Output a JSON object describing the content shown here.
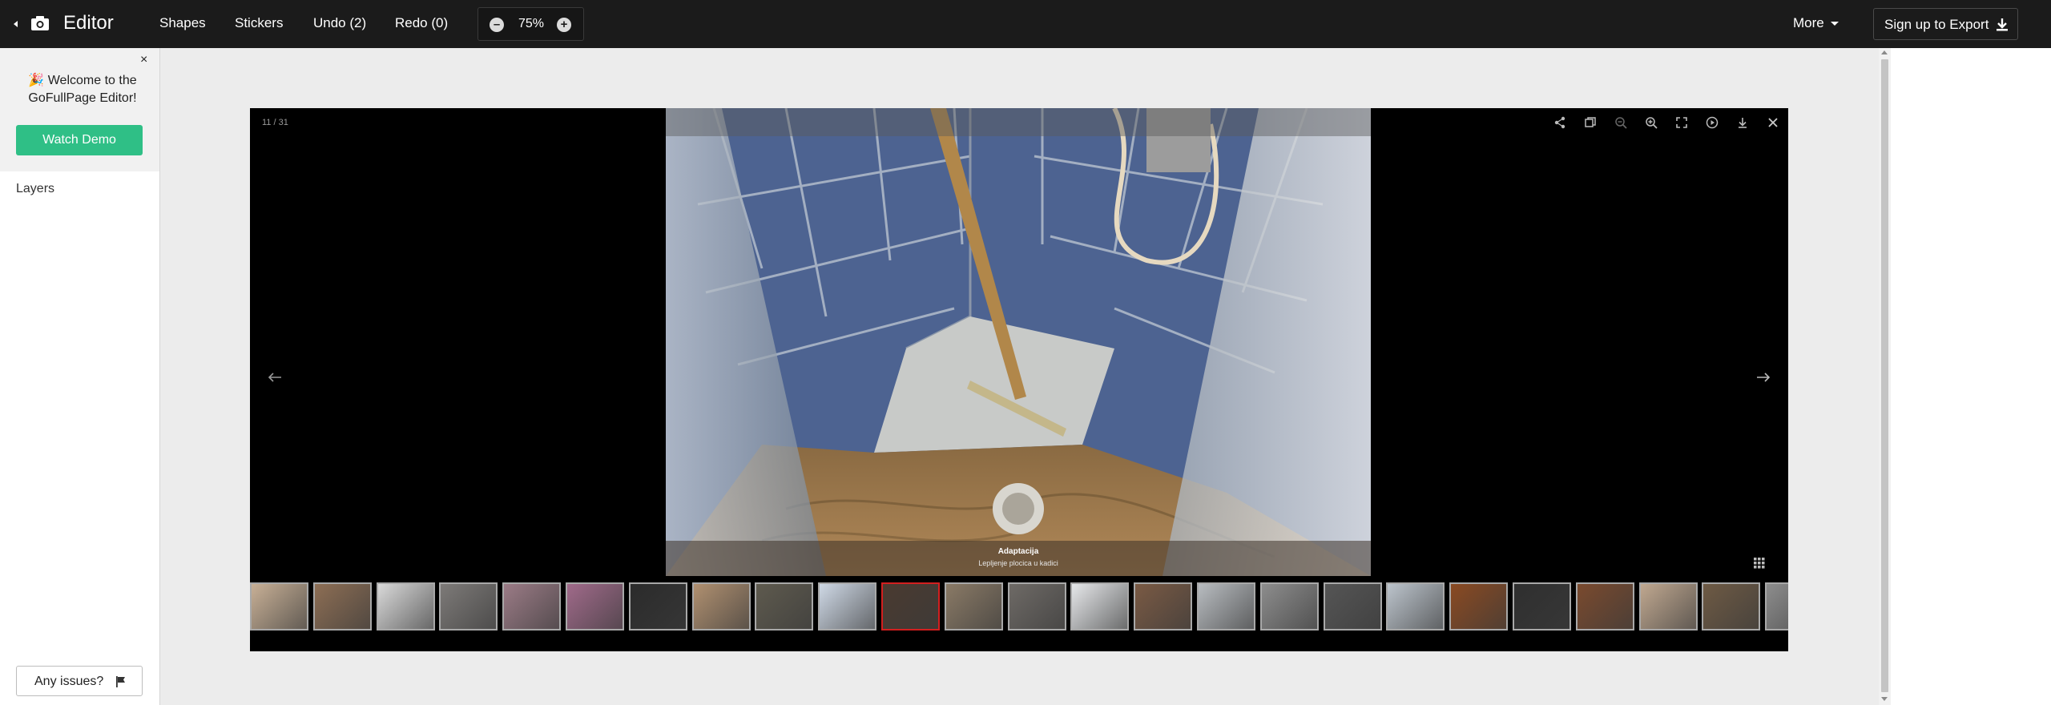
{
  "topbar": {
    "title": "Editor",
    "shapes": "Shapes",
    "stickers": "Stickers",
    "undo": "Undo (2)",
    "redo": "Redo (0)",
    "zoom_minus": "–",
    "zoom_value": "75%",
    "zoom_plus": "+",
    "more": "More",
    "signup": "Sign up to Export"
  },
  "sidebar": {
    "welcome_close": "×",
    "welcome_text": "🎉 Welcome to the GoFullPage Editor!",
    "watch_demo": "Watch Demo",
    "layers": "Layers",
    "issues": "Any issues?"
  },
  "lightbox": {
    "counter": "11 / 31",
    "caption_title": "Adaptacija",
    "caption_subtitle": "Lepljenje plocica u kadici",
    "active_thumb_index": 10,
    "thumb_colors": [
      "#c8b096",
      "#8d6e54",
      "#d9d9d9",
      "#7d7a78",
      "#9b7b86",
      "#a06a8a",
      "#2b2b2b",
      "#b09070",
      "#5e5a4e",
      "#cfd9e6",
      "#4a3a30",
      "#8a7a66",
      "#6e6a66",
      "#e6e8ea",
      "#7a5a44",
      "#b8bcc0",
      "#8d8d8d",
      "#555555",
      "#bcc4cc",
      "#8a4a22",
      "#2f2f2f",
      "#7a4a2e",
      "#c0a890",
      "#6e5a44",
      "#8d8d8d"
    ]
  },
  "colors": {
    "topbar_bg": "#1b1b1b",
    "accent": "#2fbf86",
    "active_thumb_border": "#d21f1f"
  }
}
